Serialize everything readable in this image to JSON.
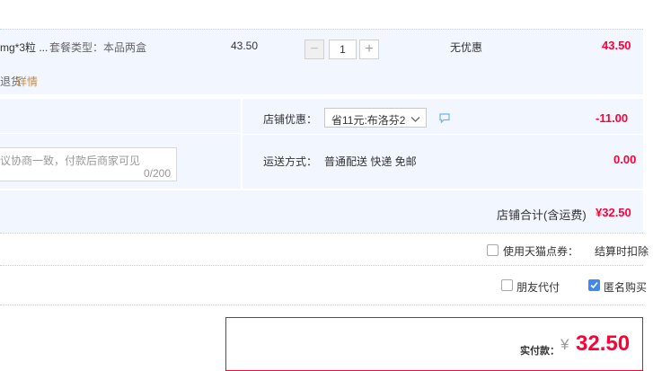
{
  "item": {
    "name_truncated": "mg*3粒 ...",
    "package_label": "套餐类型：本品两盒",
    "unit_price": "43.50",
    "quantity": "1",
    "discount_label": "无优惠",
    "subtotal": "43.50",
    "service_text": "退货",
    "detail_link": "详情",
    "minus_symbol": "−",
    "plus_symbol": "+"
  },
  "shop": {
    "promo_label": "店铺优惠：",
    "promo_value": "省11元:布洛芬2",
    "promo_amount": "-11.00",
    "shipping_label": "运送方式：",
    "shipping_value": "普通配送 快递 免邮",
    "shipping_amount": "0.00",
    "message_placeholder": "议协商一致，付款后商家可见",
    "message_count": "0/200",
    "total_label": "店铺合计(含运费)",
    "total_value": "¥32.50"
  },
  "options": {
    "tmall_points_label": "使用天猫点券：",
    "tmall_points_note": "结算时扣除",
    "friend_pay_label": "朋友代付",
    "anonymous_label": "匿名购买",
    "friend_pay_checked": false,
    "anonymous_checked": true
  },
  "payment": {
    "label": "实付款：",
    "currency": "¥",
    "amount": "32.50"
  },
  "colors": {
    "accent_red": "#ff0036",
    "band_blue": "#f2f7ff",
    "link_orange": "#c38c4f",
    "checkbox_blue": "#3d89f5"
  }
}
